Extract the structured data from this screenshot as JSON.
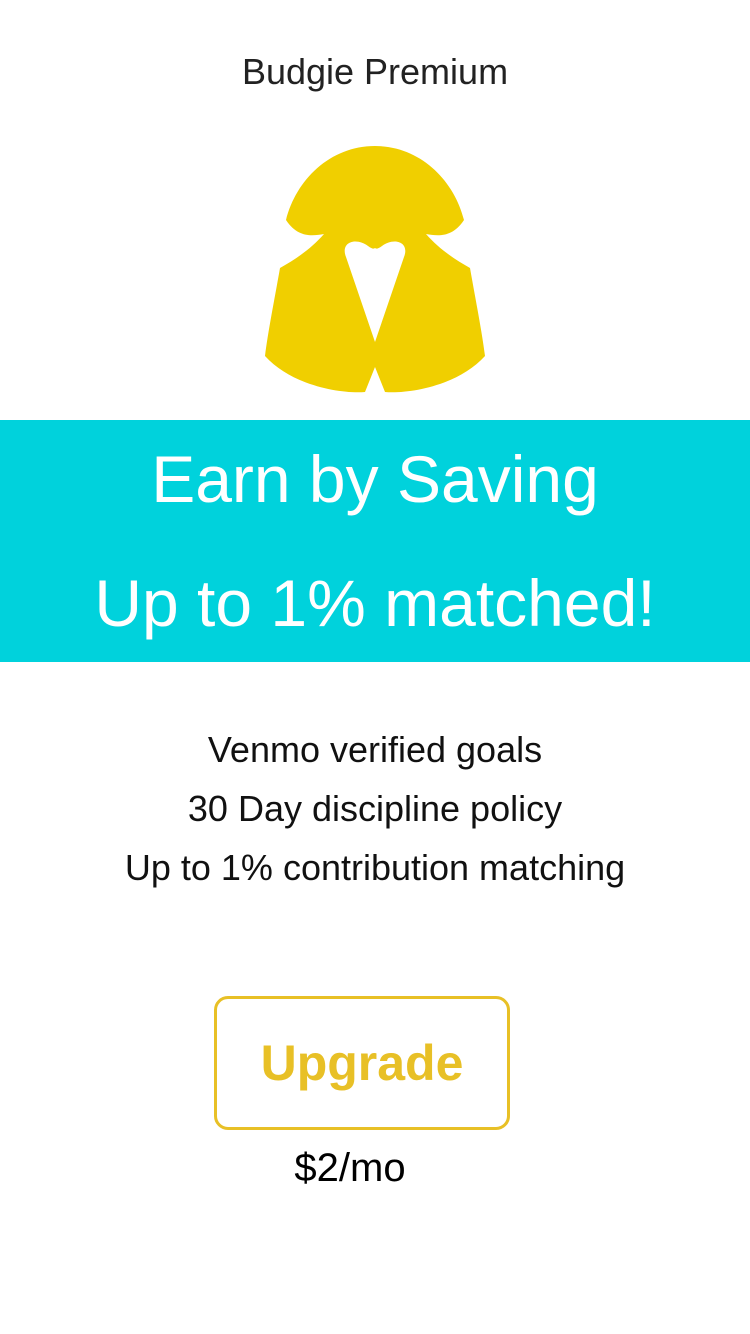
{
  "header": {
    "title": "Budgie Premium"
  },
  "logo": {
    "icon": "budgie-bird-logo",
    "color": "#f0cf00"
  },
  "banner": {
    "line1": "Earn by Saving",
    "line2": "Up to 1% matched!",
    "background": "#00d2dc"
  },
  "features": [
    "Venmo verified goals",
    "30 Day discipline policy",
    "Up to 1% contribution matching"
  ],
  "upgrade": {
    "label": "Upgrade",
    "price": "$2/mo",
    "accent": "#e8c026"
  }
}
